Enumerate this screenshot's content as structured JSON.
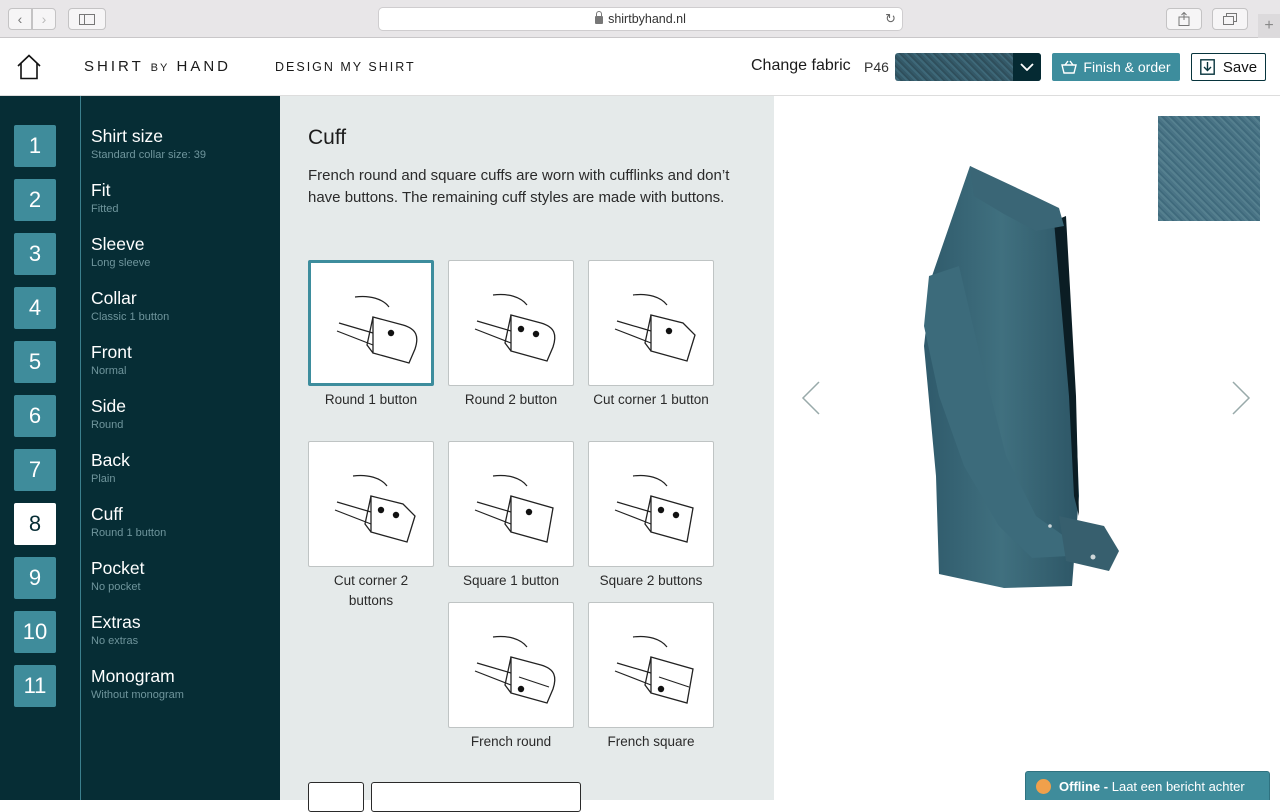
{
  "browser": {
    "url": "shirtbyhand.nl"
  },
  "header": {
    "logo_main": "SHIRT",
    "logo_by": "BY",
    "logo_hand": "HAND",
    "nav_design": "DESIGN MY SHIRT",
    "change_fabric": "Change fabric",
    "fabric_code": "P46",
    "finish_label": "Finish & order",
    "save_label": "Save"
  },
  "steps": [
    {
      "num": "1",
      "title": "Shirt size",
      "sub": "Standard collar size: 39"
    },
    {
      "num": "2",
      "title": "Fit",
      "sub": "Fitted"
    },
    {
      "num": "3",
      "title": "Sleeve",
      "sub": "Long sleeve"
    },
    {
      "num": "4",
      "title": "Collar",
      "sub": "Classic 1 button"
    },
    {
      "num": "5",
      "title": "Front",
      "sub": "Normal"
    },
    {
      "num": "6",
      "title": "Side",
      "sub": "Round"
    },
    {
      "num": "7",
      "title": "Back",
      "sub": "Plain"
    },
    {
      "num": "8",
      "title": "Cuff",
      "sub": "Round 1 button"
    },
    {
      "num": "9",
      "title": "Pocket",
      "sub": "No pocket"
    },
    {
      "num": "10",
      "title": "Extras",
      "sub": "No extras"
    },
    {
      "num": "11",
      "title": "Monogram",
      "sub": "Without monogram"
    }
  ],
  "active_step": 8,
  "panel": {
    "title": "Cuff",
    "description": "French round and square cuffs are worn with cufflinks and don’t have buttons. The remaining cuff styles are made with buttons.",
    "options": [
      {
        "label": "Round 1 button",
        "selected": true
      },
      {
        "label": "Round 2 button",
        "selected": false
      },
      {
        "label": "Cut corner 1 button",
        "selected": false
      },
      {
        "label": "Cut corner 2 buttons",
        "selected": false
      },
      {
        "label": "Square 1 button",
        "selected": false
      },
      {
        "label": "Square 2 buttons",
        "selected": false
      },
      {
        "label": "French round",
        "selected": false
      },
      {
        "label": "French square",
        "selected": false
      }
    ]
  },
  "chat": {
    "status": "Offline -",
    "message": "Laat een bericht achter"
  },
  "colors": {
    "sidebar": "#062d35",
    "accent": "#3d8d9d",
    "panel": "#e5eaea",
    "shirt": "#3b6a7c"
  }
}
